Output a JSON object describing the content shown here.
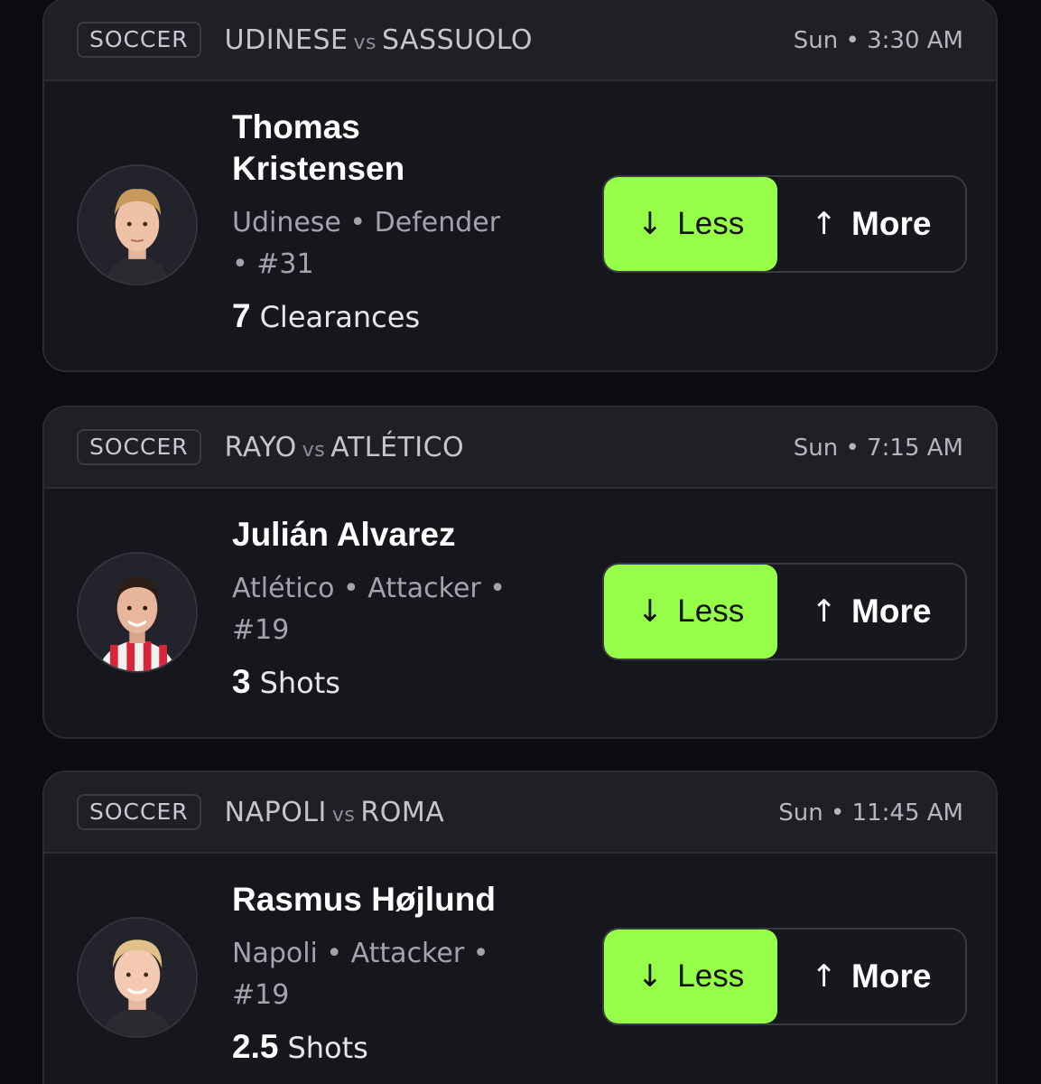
{
  "cards": [
    {
      "sport": "SOCCER",
      "team_home": "UDINESE",
      "vs": "vs",
      "team_away": "SASSUOLO",
      "time": "Sun • 3:30 AM",
      "player_name_line1": "Thomas",
      "player_name_line2": "Kristensen",
      "meta_line1": "Udinese • Defender",
      "meta_line2": "• #31",
      "stat_value": "7",
      "stat_label": "Clearances",
      "less_label": "Less",
      "more_label": "More",
      "avatar_icon": "player-headshot-icon",
      "jersey_color": "#2a2a30"
    },
    {
      "sport": "SOCCER",
      "team_home": "RAYO",
      "vs": "vs",
      "team_away": "ATLÉTICO",
      "time": "Sun • 7:15 AM",
      "player_name_line1": "Julián Alvarez",
      "meta_line1": "Atlético • Attacker •",
      "meta_line2": "#19",
      "stat_value": "3",
      "stat_label": "Shots",
      "less_label": "Less",
      "more_label": "More",
      "avatar_icon": "player-headshot-icon",
      "jersey_color": "#d6263a"
    },
    {
      "sport": "SOCCER",
      "team_home": "NAPOLI",
      "vs": "vs",
      "team_away": "ROMA",
      "time": "Sun • 11:45 AM",
      "player_name_line1": "Rasmus Højlund",
      "meta_line1": "Napoli • Attacker •",
      "meta_line2": "#19",
      "stat_value": "2.5",
      "stat_label": "Shots",
      "less_label": "Less",
      "more_label": "More",
      "avatar_icon": "player-headshot-icon",
      "jersey_color": "#2a2a30"
    }
  ],
  "icons": {
    "less": "arrow-down-icon",
    "more": "arrow-up-icon"
  },
  "colors": {
    "background": "#0b0b10",
    "card": "#16161d",
    "header": "#1f1f26",
    "accent_less": "#96ff47"
  }
}
